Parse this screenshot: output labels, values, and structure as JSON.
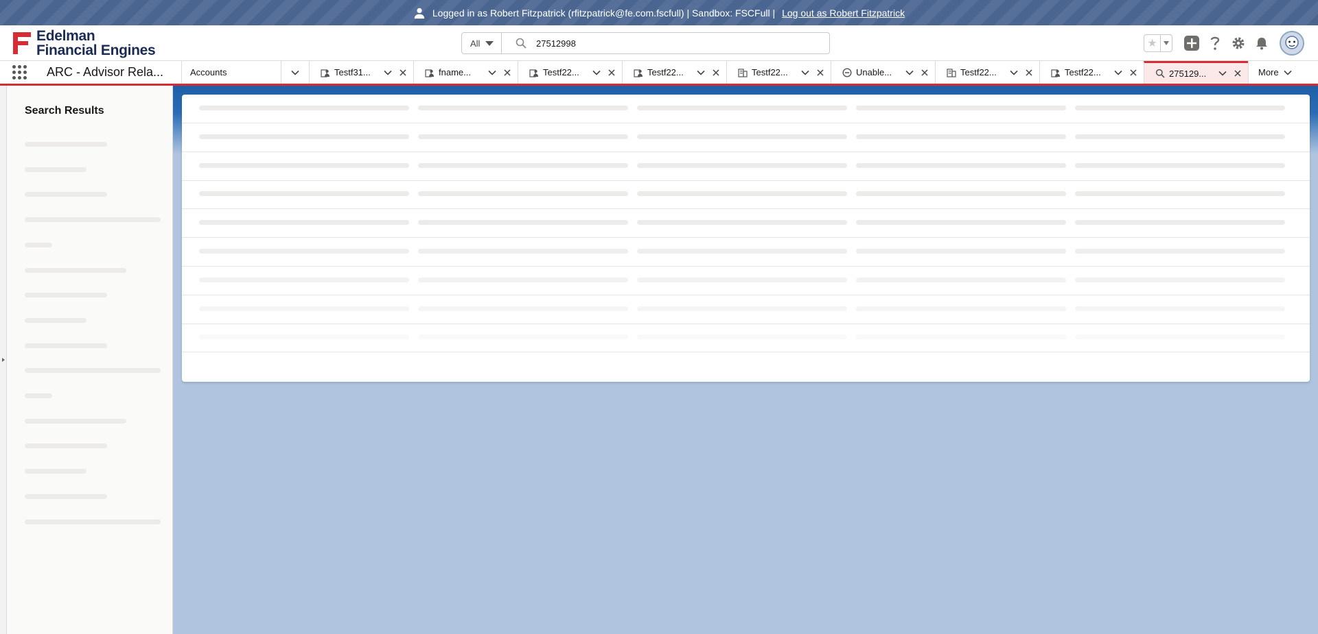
{
  "banner": {
    "text": "Logged in as Robert Fitzpatrick (rfitzpatrick@fe.com.fscfull) | Sandbox: FSCFull |",
    "logout": "Log out as Robert Fitzpatrick"
  },
  "logo": {
    "line1": "Edelman",
    "line2": "Financial Engines"
  },
  "search": {
    "scope": "All",
    "value": "27512998"
  },
  "nav": {
    "app_name": "ARC - Advisor Rela...",
    "accounts": "Accounts",
    "tabs": [
      {
        "label": "Testf31...",
        "icon": "person-account-icon"
      },
      {
        "label": "fname...",
        "icon": "person-account-icon"
      },
      {
        "label": "Testf22...",
        "icon": "person-account-icon"
      },
      {
        "label": "Testf22...",
        "icon": "person-account-icon"
      },
      {
        "label": "Testf22...",
        "icon": "household-icon"
      },
      {
        "label": "Unable...",
        "icon": "error-icon"
      },
      {
        "label": "Testf22...",
        "icon": "household-icon"
      },
      {
        "label": "Testf22...",
        "icon": "person-account-icon"
      },
      {
        "label": "275129...",
        "icon": "search-icon"
      }
    ],
    "more": "More"
  },
  "sidebar": {
    "title": "Search Results"
  },
  "colors": {
    "brand_red": "#d62d35",
    "brand_navy": "#1b2b55",
    "banner": "#4a6590",
    "content_bg": "#b0c4df"
  }
}
